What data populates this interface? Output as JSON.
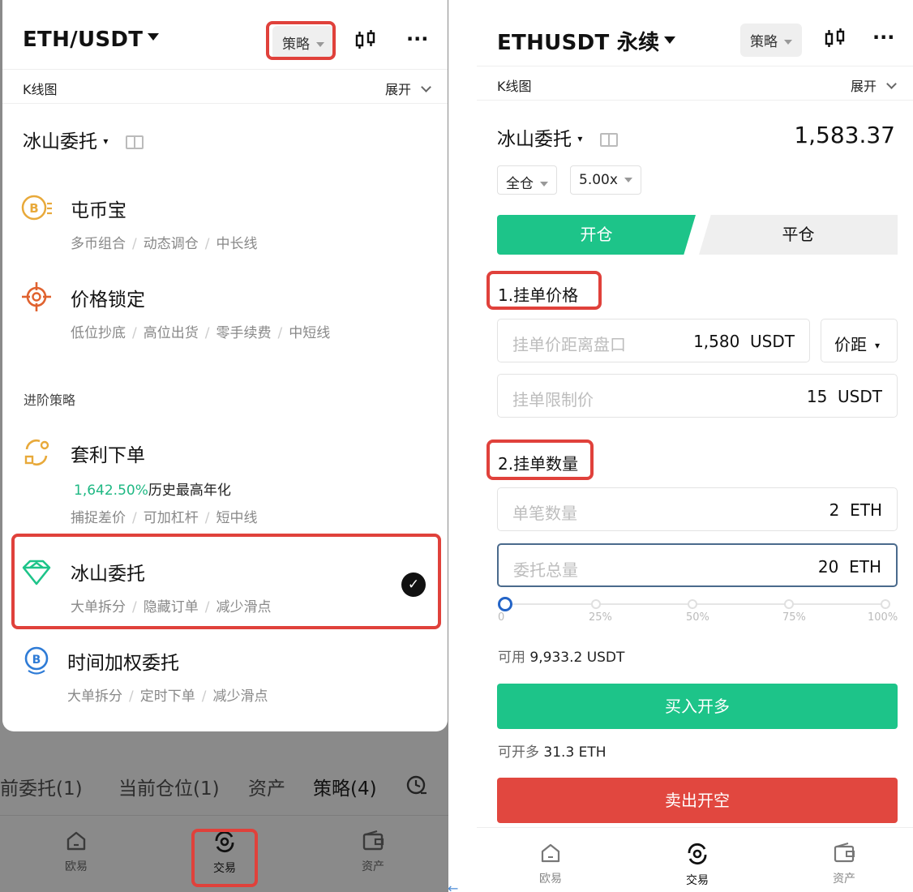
{
  "left": {
    "pair": "ETH/USDT",
    "strategy_btn": "策略",
    "more": "···",
    "kline": "K线图",
    "expand": "展开",
    "current_title": "冰山委托",
    "strategies": [
      {
        "name": "屯币宝",
        "tags": [
          "多币组合",
          "动态调仓",
          "中长线"
        ]
      },
      {
        "name": "价格锁定",
        "tags": [
          "低位抄底",
          "高位出货",
          "零手续费",
          "中短线"
        ]
      }
    ],
    "advanced_label": "进阶策略",
    "arbitrage": {
      "name": "套利下单",
      "rate": "1,642.50%",
      "rate_text": "历史最高年化",
      "tags": [
        "捕捉差价",
        "可加杠杆",
        "短中线"
      ]
    },
    "iceberg": {
      "name": "冰山委托",
      "tags": [
        "大单拆分",
        "隐藏订单",
        "减少滑点"
      ]
    },
    "twap": {
      "name": "时间加权委托",
      "tags": [
        "大单拆分",
        "定时下单",
        "减少滑点"
      ]
    },
    "tabs": [
      "前委托(1)",
      "当前仓位(1)",
      "资产",
      "策略(4)"
    ],
    "nav": [
      "欧易",
      "交易",
      "资产"
    ]
  },
  "right": {
    "pair": "ETHUSDT 永续",
    "strategy_btn": "策略",
    "more": "···",
    "kline": "K线图",
    "expand": "展开",
    "current_title": "冰山委托",
    "last_price": "1,583.37",
    "margin_mode": "全仓",
    "leverage": "5.00x",
    "open": "开仓",
    "close": "平仓",
    "step1": "1.挂单价格",
    "price_distance": {
      "placeholder": "挂单价距离盘口",
      "value": "1,580",
      "unit": "USDT"
    },
    "distance_select": "价距",
    "limit_price": {
      "placeholder": "挂单限制价",
      "value": "15",
      "unit": "USDT"
    },
    "step2": "2.挂单数量",
    "single_qty": {
      "placeholder": "单笔数量",
      "value": "2",
      "unit": "ETH"
    },
    "total_qty": {
      "placeholder": "委托总量",
      "value": "20",
      "unit": "ETH"
    },
    "slider": {
      "value_percent": 0,
      "labels": [
        "0",
        "25%",
        "50%",
        "75%",
        "100%"
      ]
    },
    "available_label": "可用",
    "available_value": "9,933.2 USDT",
    "buy_btn": "买入开多",
    "can_open_label": "可开多",
    "can_open_value": "31.3 ETH",
    "sell_btn": "卖出开空",
    "nav": [
      "欧易",
      "交易",
      "资产"
    ]
  },
  "colors": {
    "green": "#1dc489",
    "red": "#e1473f",
    "highlight": "#e0413b",
    "blue": "#2364c7"
  },
  "icons": [
    "candlestick-icon",
    "book-icon",
    "coin-b-icon",
    "target-icon",
    "arbitrage-icon",
    "iceberg-icon",
    "clock-b-icon",
    "home-icon",
    "trade-icon",
    "wallet-icon",
    "check-icon",
    "history-icon"
  ]
}
